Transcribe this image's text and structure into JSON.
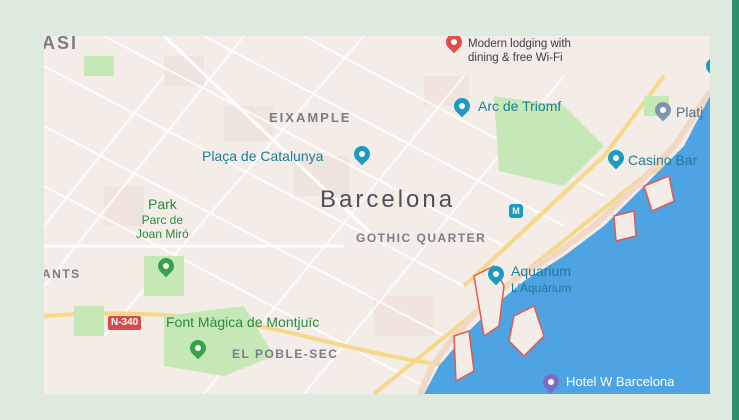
{
  "map": {
    "city": "Barcelona",
    "districts": {
      "eixample": "EIXAMPLE",
      "gothic": "GOTHIC QUARTER",
      "poble_sec": "EL POBLE-SEC",
      "ants": "ANTS",
      "asi": "ASI"
    },
    "pois": {
      "hotel_desc_line1": "Modern lodging with",
      "hotel_desc_line2": "dining & free Wi-Fi",
      "arc": "Arc de Triomf",
      "placa": "Plaça de Catalunya",
      "platja": "Platj",
      "casino": "Casino Bar",
      "park": "Park",
      "parc_line1": "Parc de",
      "parc_line2": "Joan Miró",
      "aquarium": "Aquarium",
      "aquarium_local": "L'Aquàrium",
      "font": "Font Màgica de Montjuïc",
      "hotel_w": "Hotel W Barcelona"
    },
    "road_shield": "N-340",
    "icons": [
      "hotel-pin-icon",
      "park-pin-icon",
      "attraction-pin-icon",
      "metro-icon",
      "beach-pin-icon"
    ]
  },
  "colors": {
    "land": "#f4ece7",
    "sea": "#4ea3e3",
    "park": "#c6e8b6",
    "accent_bar": "#2f8f6a"
  }
}
